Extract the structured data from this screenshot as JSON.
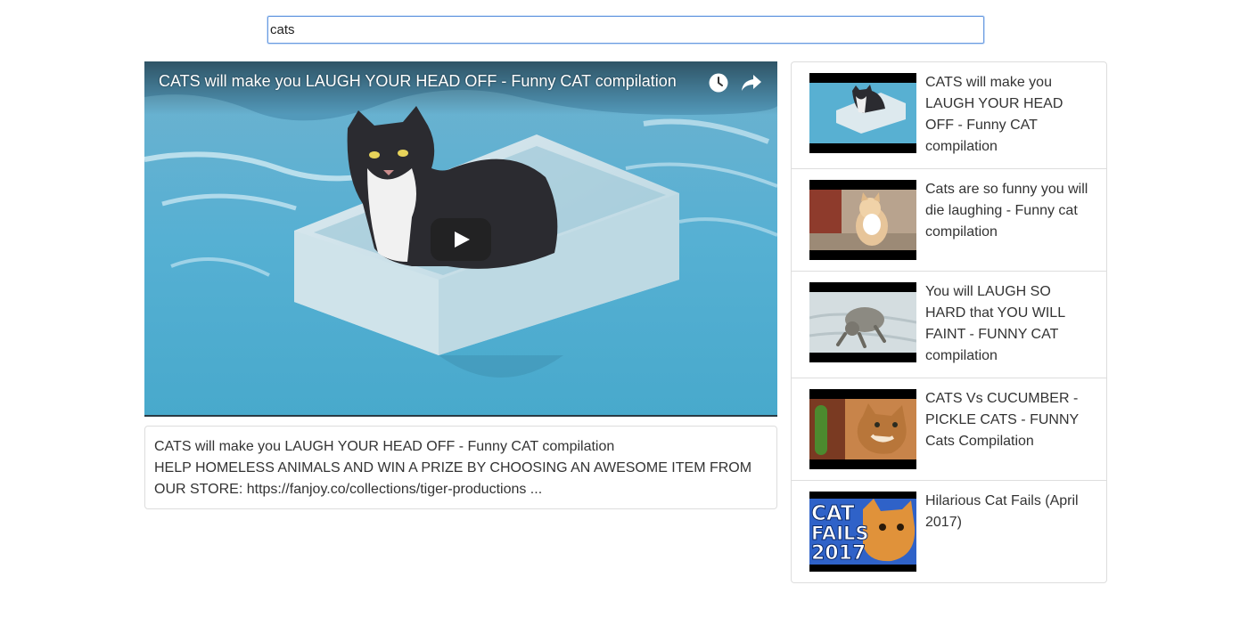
{
  "search": {
    "value": "cats"
  },
  "player": {
    "title": "CATS will make you LAUGH YOUR HEAD OFF - Funny CAT compilation",
    "icons": [
      "clock-icon",
      "share-arrow-icon",
      "play-icon"
    ],
    "accent_color": "#5ab8d8"
  },
  "details": {
    "title": "CATS will make you LAUGH YOUR HEAD OFF - Funny CAT compilation",
    "description": "HELP HOMELESS ANIMALS AND WIN A PRIZE BY CHOOSING AN AWESOME ITEM FROM OUR STORE: https://fanjoy.co/collections/tiger-productions ..."
  },
  "video_list": [
    {
      "title": "CATS will make you LAUGH YOUR HEAD OFF - Funny CAT compilation"
    },
    {
      "title": "Cats are so funny you will die laughing - Funny cat compilation"
    },
    {
      "title": "You will LAUGH SO HARD that YOU WILL FAINT - FUNNY CAT compilation"
    },
    {
      "title": "CATS Vs CUCUMBER - PICKLE CATS - FUNNY Cats Compilation"
    },
    {
      "title": "Hilarious Cat Fails (April 2017)"
    }
  ],
  "thumb_text": {
    "line1": "CAT",
    "line2": "FAILS",
    "line3": "2017"
  }
}
